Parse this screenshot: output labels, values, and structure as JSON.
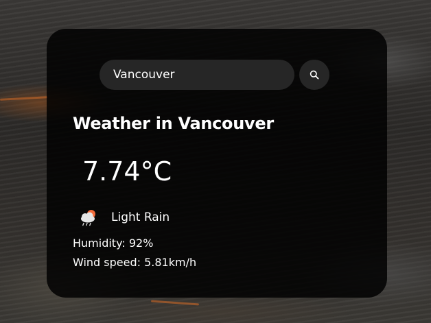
{
  "search": {
    "value": "Vancouver",
    "button_icon": "search-icon"
  },
  "weather": {
    "title": "Weather in Vancouver",
    "temperature": "7.74°C",
    "condition_icon": "rain-cloud-icon",
    "condition": "Light Rain",
    "humidity": "Humidity: 92%",
    "wind": "Wind speed: 5.81km/h"
  },
  "colors": {
    "card_background": "#000000",
    "input_background": "#262626",
    "text": "#ffffff",
    "sun": "#f26b3a",
    "cloud": "#e6e6e6"
  }
}
